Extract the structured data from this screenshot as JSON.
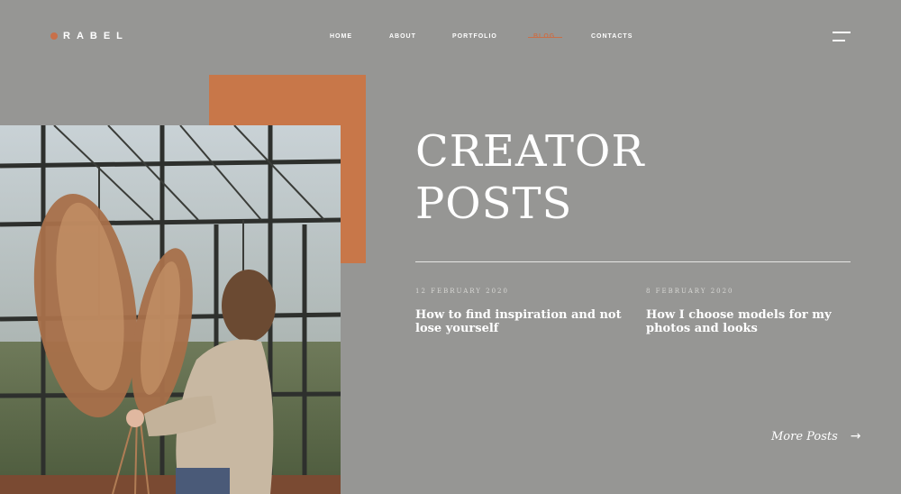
{
  "brand": {
    "name": "RABEL",
    "accent_color": "#c8704a"
  },
  "nav": {
    "items": [
      {
        "label": "HOME"
      },
      {
        "label": "ABOUT"
      },
      {
        "label": "PORTFOLIO"
      },
      {
        "label": "BLOG",
        "active": true
      },
      {
        "label": "CONTACTS"
      }
    ],
    "menu_icon": "hamburger-icon"
  },
  "hero": {
    "title_line1": "CREATOR",
    "title_line2": "POSTS"
  },
  "posts": [
    {
      "date": "12 FEBRUARY 2020",
      "title": "How to find inspiration and not lose yourself"
    },
    {
      "date": "8 FEBRUARY 2020",
      "title": "How I choose models for my photos and looks"
    }
  ],
  "more": {
    "label": "More Posts",
    "icon": "arrow-right-icon"
  },
  "colors": {
    "background": "#969694",
    "accent_block": "#c87749",
    "text": "#ffffff"
  }
}
